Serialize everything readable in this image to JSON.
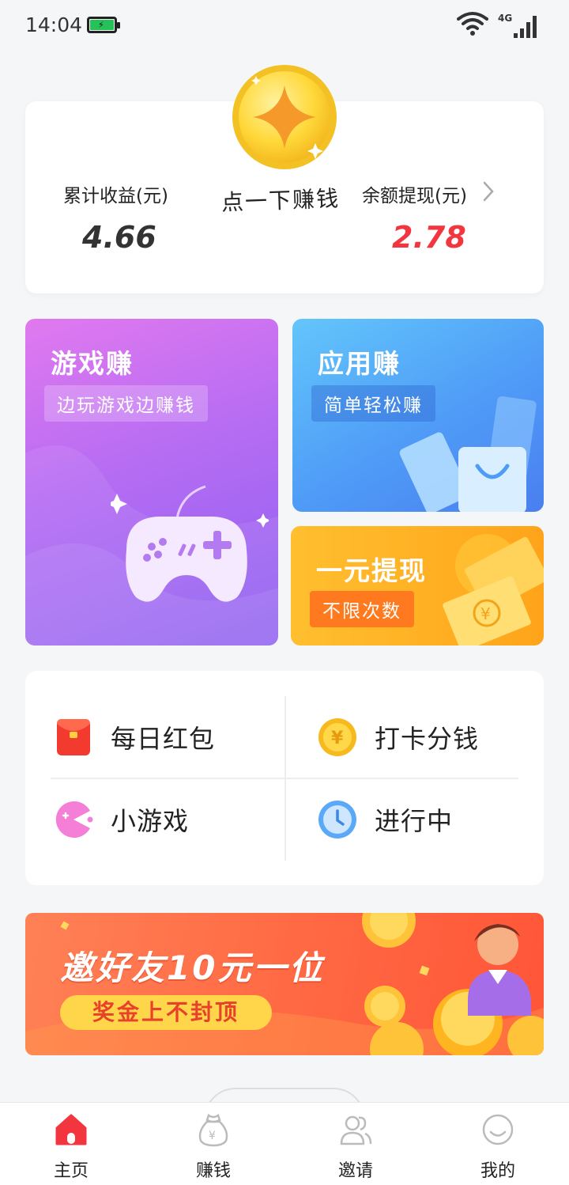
{
  "status_bar": {
    "time": "14:04",
    "network": "4G",
    "icons": [
      "battery-charging-icon",
      "wifi-icon",
      "cell-signal-icon"
    ]
  },
  "earnings": {
    "total_label": "累计收益(元)",
    "total_value": "4.66",
    "balance_label": "余额提现(元)",
    "balance_value": "2.78",
    "tap_text": "点一下赚钱",
    "colors": {
      "balance": "#f2353f",
      "total": "#333333"
    }
  },
  "tiles": {
    "game": {
      "title": "游戏赚",
      "subtitle": "边玩游戏边赚钱"
    },
    "app": {
      "title": "应用赚",
      "subtitle": "简单轻松赚"
    },
    "cash": {
      "title": "一元提现",
      "subtitle": "不限次数"
    }
  },
  "menu": [
    {
      "label": "每日红包",
      "icon": "red-envelope-icon"
    },
    {
      "label": "打卡分钱",
      "icon": "gold-coin-icon"
    },
    {
      "label": "小游戏",
      "icon": "pacman-icon"
    },
    {
      "label": "进行中",
      "icon": "clock-icon"
    }
  ],
  "banner": {
    "title": "邀好友10元一位",
    "pill": "奖金上不封顶"
  },
  "tabbar": [
    {
      "label": "主页",
      "icon": "home-icon",
      "active": true
    },
    {
      "label": "赚钱",
      "icon": "money-bag-icon",
      "active": false
    },
    {
      "label": "邀请",
      "icon": "users-icon",
      "active": false
    },
    {
      "label": "我的",
      "icon": "smile-icon",
      "active": false
    }
  ],
  "accent": "#f2353f"
}
